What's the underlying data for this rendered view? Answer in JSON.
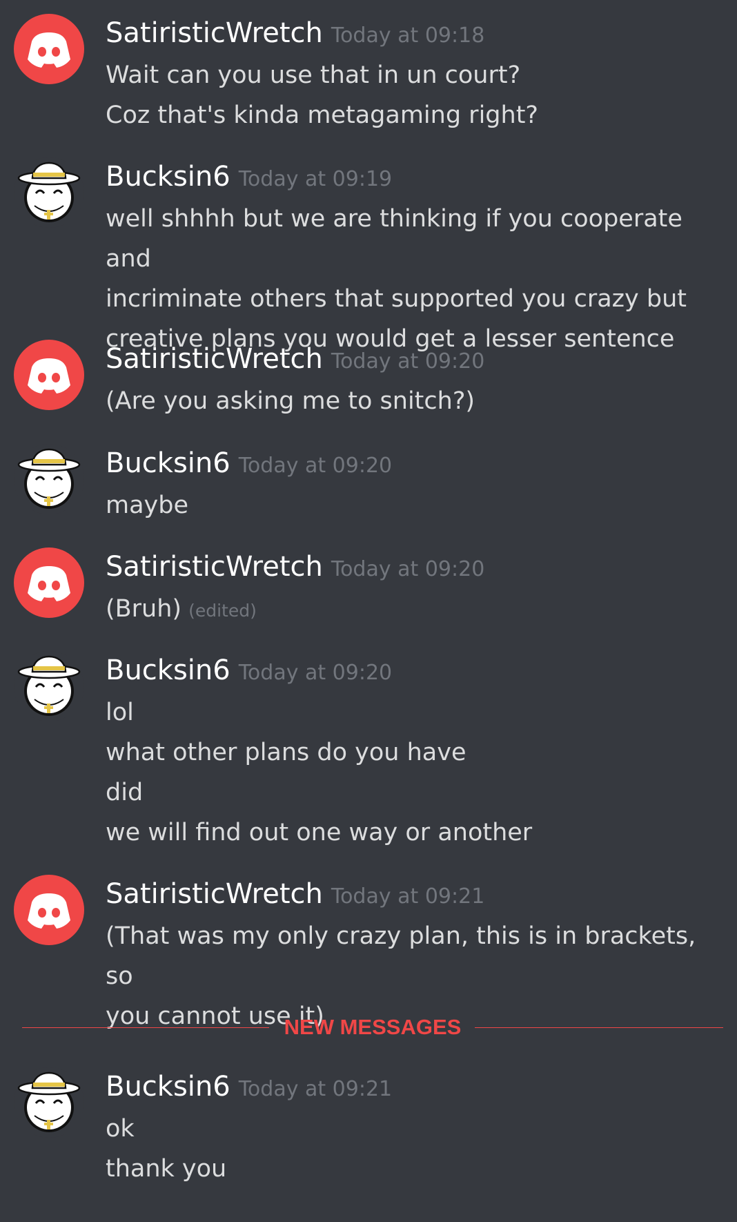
{
  "colors": {
    "background": "#36393f",
    "username": "#ffffff",
    "message_text": "#dcddde",
    "timestamp": "#72767d",
    "new_messages_accent": "#f04747",
    "default_avatar_bg": "#f04747"
  },
  "messages": [
    {
      "author": "SatiristicWretch",
      "avatar": "discord-default-avatar-icon",
      "timestamp": "Today at 09:18",
      "lines": [
        "Wait can you use that in un court?",
        "Coz that's kinda metagaming right?"
      ]
    },
    {
      "author": "Bucksin6",
      "avatar": "priest-ball-avatar-icon",
      "timestamp": "Today at 09:19",
      "lines": [
        "well shhhh but we are thinking if you cooperate and",
        "incriminate others that supported you crazy but",
        "creative plans you would get a lesser sentence"
      ]
    },
    {
      "author": "SatiristicWretch",
      "avatar": "discord-default-avatar-icon",
      "timestamp": "Today at 09:20",
      "lines": [
        "(Are you asking me to snitch?)"
      ]
    },
    {
      "author": "Bucksin6",
      "avatar": "priest-ball-avatar-icon",
      "timestamp": "Today at 09:20",
      "lines": [
        "maybe"
      ]
    },
    {
      "author": "SatiristicWretch",
      "avatar": "discord-default-avatar-icon",
      "timestamp": "Today at 09:20",
      "lines": [
        "(Bruh)"
      ],
      "edited_label": "(edited)"
    },
    {
      "author": "Bucksin6",
      "avatar": "priest-ball-avatar-icon",
      "timestamp": "Today at 09:20",
      "lines": [
        "lol",
        "what other plans do you have",
        "did",
        "we will find out one way or another"
      ]
    },
    {
      "author": "SatiristicWretch",
      "avatar": "discord-default-avatar-icon",
      "timestamp": "Today at 09:21",
      "lines": [
        "(That was my only crazy plan, this is in brackets, so",
        "you cannot use it)"
      ]
    },
    {
      "author": "Bucksin6",
      "avatar": "priest-ball-avatar-icon",
      "timestamp": "Today at 09:21",
      "lines": [
        "ok",
        "thank you"
      ]
    }
  ],
  "new_messages_divider": {
    "label": "NEW MESSAGES"
  }
}
